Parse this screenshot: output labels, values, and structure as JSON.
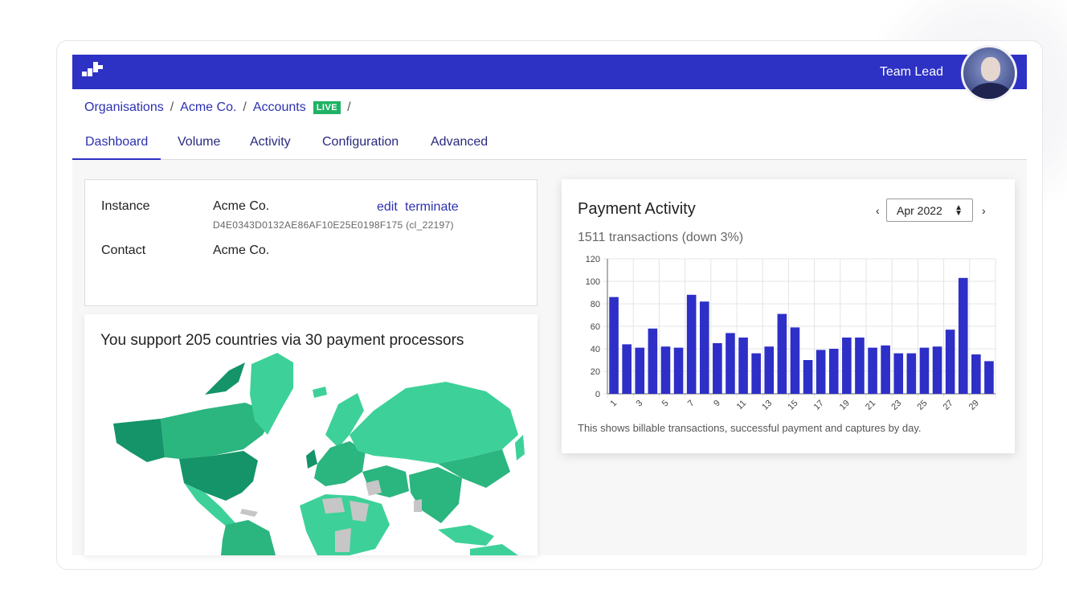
{
  "header": {
    "user_label": "Team Lead",
    "bar_color": "#2d31c4"
  },
  "breadcrumb": {
    "items": [
      "Organisations",
      "Acme Co.",
      "Accounts"
    ],
    "badge": "LIVE",
    "separator": "/"
  },
  "tabs": [
    {
      "label": "Dashboard",
      "active": true
    },
    {
      "label": "Volume",
      "active": false
    },
    {
      "label": "Activity",
      "active": false
    },
    {
      "label": "Configuration",
      "active": false
    },
    {
      "label": "Advanced",
      "active": false
    }
  ],
  "instance": {
    "instance_label": "Instance",
    "instance_value": "Acme Co.",
    "instance_id": "D4E0343D0132AE86AF10E25E0198F175 (cl_22197)",
    "edit_link": "edit",
    "terminate_link": "terminate",
    "contact_label": "Contact",
    "contact_value": "Acme Co."
  },
  "map": {
    "title": "You support 205 countries via 30 payment processors",
    "colors": {
      "dark": "#149468",
      "mid": "#2bb57f",
      "light": "#3dd199",
      "none": "#c6c6c6"
    }
  },
  "payment": {
    "title": "Payment Activity",
    "summary": "1511 transactions (down 3%)",
    "month": "Apr 2022",
    "prev_icon": "chevron-left-icon",
    "next_icon": "chevron-right-icon",
    "note": "This shows billable transactions, successful payment and captures by day."
  },
  "chart_data": {
    "type": "bar",
    "categories": [
      "1",
      "2",
      "3",
      "4",
      "5",
      "6",
      "7",
      "8",
      "9",
      "10",
      "11",
      "12",
      "13",
      "14",
      "15",
      "16",
      "17",
      "18",
      "19",
      "20",
      "21",
      "22",
      "23",
      "24",
      "25",
      "26",
      "27",
      "28",
      "29",
      "30"
    ],
    "tick_labels": [
      "1",
      "3",
      "5",
      "7",
      "9",
      "11",
      "13",
      "15",
      "17",
      "19",
      "21",
      "23",
      "25",
      "27",
      "29"
    ],
    "values": [
      86,
      44,
      41,
      58,
      42,
      41,
      88,
      82,
      45,
      54,
      50,
      36,
      42,
      71,
      59,
      30,
      39,
      40,
      50,
      50,
      41,
      43,
      36,
      36,
      41,
      42,
      57,
      103,
      35,
      29
    ],
    "ylim": [
      0,
      120
    ],
    "yticks": [
      0,
      20,
      40,
      60,
      80,
      100,
      120
    ],
    "grid": true,
    "bar_color": "#2d2fc7"
  }
}
